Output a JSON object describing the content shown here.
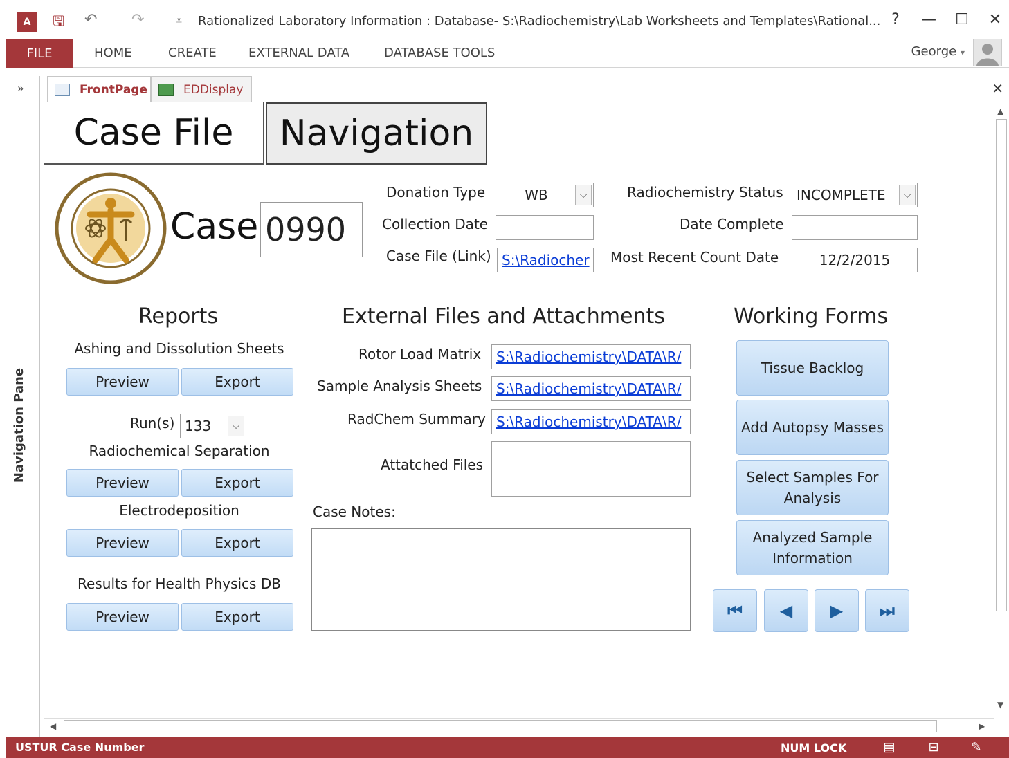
{
  "window": {
    "title": "Rationalized Laboratory Information : Database- S:\\Radiochemistry\\Lab Worksheets and Templates\\Rational...",
    "help": "?",
    "minimize": "—",
    "maximize": "☐",
    "close": "✕"
  },
  "ribbon": {
    "tabs": [
      "FILE",
      "HOME",
      "CREATE",
      "EXTERNAL DATA",
      "DATABASE TOOLS"
    ],
    "user": "George"
  },
  "nav_pane": {
    "label": "Navigation Pane",
    "toggle": "»"
  },
  "doc_tabs": [
    {
      "label": "FrontPage",
      "active": true
    },
    {
      "label": "EDDisplay",
      "active": false
    }
  ],
  "form": {
    "case_file_tab": "Case File",
    "navigation_tab": "Navigation",
    "case_label": "Case",
    "case_number": "0990",
    "donation_type_label": "Donation Type",
    "donation_type_value": "WB",
    "collection_date_label": "Collection Date",
    "collection_date_value": "",
    "case_file_link_label": "Case File (Link)",
    "case_file_link_value": "S:\\Radiocher",
    "radchem_status_label": "Radiochemistry Status",
    "radchem_status_value": "INCOMPLETE",
    "date_complete_label": "Date Complete",
    "date_complete_value": "",
    "recent_count_label": "Most Recent Count Date",
    "recent_count_value": "12/2/2015"
  },
  "reports": {
    "heading": "Reports",
    "ashing_label": "Ashing and Dissolution Sheets",
    "runs_label": "Run(s)",
    "runs_value": "133",
    "radsep_label": "Radiochemical Separation",
    "electro_label": "Electrodeposition",
    "hpdb_label": "Results for Health Physics DB",
    "preview": "Preview",
    "export": "Export"
  },
  "external": {
    "heading": "External Files and Attachments",
    "rotor_label": "Rotor Load Matrix",
    "rotor_value": "S:\\Radiochemistry\\DATA\\R/",
    "sample_label": "Sample Analysis Sheets",
    "sample_value": "S:\\Radiochemistry\\DATA\\R/",
    "summary_label": "RadChem Summary",
    "summary_value": "S:\\Radiochemistry\\DATA\\R/",
    "attached_label": "Attatched Files",
    "notes_label": "Case Notes:"
  },
  "working_forms": {
    "heading": "Working Forms",
    "buttons": [
      "Tissue Backlog",
      "Add Autopsy Masses",
      "Select Samples For Analysis",
      "Analyzed Sample Information"
    ]
  },
  "status": {
    "left": "USTUR Case Number",
    "numlock": "NUM LOCK"
  },
  "colors": {
    "accent": "#a4373a",
    "button": "#c2dcf6",
    "link": "#0b3dd6"
  }
}
